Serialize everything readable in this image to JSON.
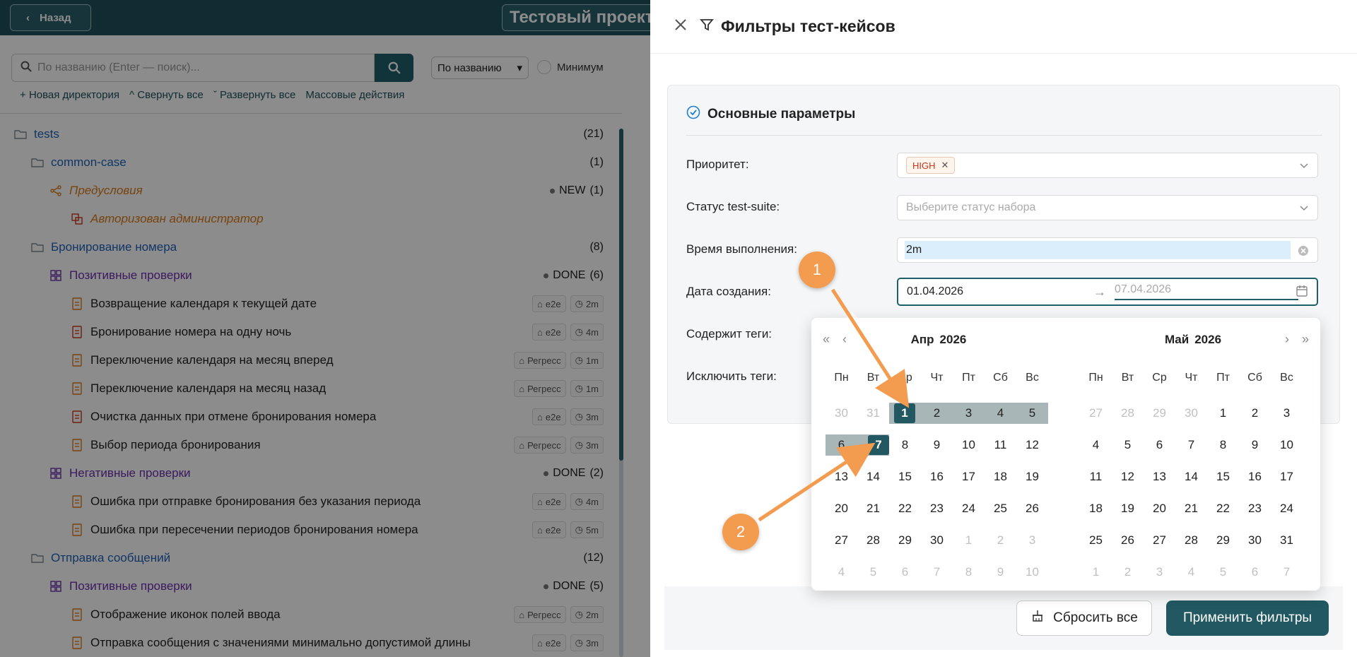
{
  "topbar": {
    "back_label": "Назад",
    "project_title": "Тестовый проект"
  },
  "search": {
    "placeholder": "По названию (Enter — поиск)...",
    "sort_value": "По названию",
    "min_label": "Минимум"
  },
  "toolbar": {
    "new_dir": "Новая директория",
    "collapse": "Свернуть все",
    "expand": "Развернуть все",
    "bulk": "Массовые действия"
  },
  "tree": [
    {
      "kind": "folder",
      "level": 0,
      "title": "tests",
      "count": "(21)"
    },
    {
      "kind": "folder",
      "level": 1,
      "title": "common-case",
      "count": "(1)"
    },
    {
      "kind": "pre",
      "level": 2,
      "title": "Предусловия",
      "status": "NEW",
      "count": "(1)"
    },
    {
      "kind": "pre-item",
      "level": 3,
      "title": "Авторизован администратор"
    },
    {
      "kind": "folder",
      "level": 1,
      "title": "Бронирование номера",
      "count": "(8)"
    },
    {
      "kind": "group",
      "level": 2,
      "title": "Позитивные проверки",
      "status": "DONE",
      "count": "(6)"
    },
    {
      "kind": "case",
      "level": 3,
      "title": "Возвращение календаря к текущей дате",
      "tag": "e2e",
      "time": "2m"
    },
    {
      "kind": "case-red",
      "level": 3,
      "title": "Бронирование номера на одну ночь",
      "tag": "e2e",
      "time": "4m"
    },
    {
      "kind": "case",
      "level": 3,
      "title": "Переключение календаря на месяц вперед",
      "tag": "Регресс",
      "time": "1m"
    },
    {
      "kind": "case",
      "level": 3,
      "title": "Переключение календаря на месяц назад",
      "tag": "Регресс",
      "time": "1m"
    },
    {
      "kind": "case-red",
      "level": 3,
      "title": "Очистка данных при отмене бронирования номера",
      "tag": "e2e",
      "time": "3m"
    },
    {
      "kind": "case",
      "level": 3,
      "title": "Выбор периода бронирования",
      "tag": "Регресс",
      "time": "3m"
    },
    {
      "kind": "group",
      "level": 2,
      "title": "Негативные проверки",
      "status": "DONE",
      "count": "(2)"
    },
    {
      "kind": "case",
      "level": 3,
      "title": "Ошибка при отправке бронирования без указания периода",
      "tag": "e2e",
      "time": "4m"
    },
    {
      "kind": "case",
      "level": 3,
      "title": "Ошибка при пересечении периодов бронирования номера",
      "tag": "e2e",
      "time": "5m"
    },
    {
      "kind": "folder",
      "level": 1,
      "title": "Отправка сообщений",
      "count": "(12)"
    },
    {
      "kind": "group",
      "level": 2,
      "title": "Позитивные проверки",
      "status": "DONE",
      "count": "(5)"
    },
    {
      "kind": "case",
      "level": 3,
      "title": "Отображение иконок полей ввода",
      "tag": "Регресс",
      "time": "2m"
    },
    {
      "kind": "case",
      "level": 3,
      "title": "Отправка сообщения с значениями минимально допустимой длины",
      "tag": "e2e",
      "time": "3m"
    }
  ],
  "drawer": {
    "title": "Фильтры тест-кейсов",
    "section_title": "Основные параметры",
    "fields": {
      "priority_label": "Приоритет:",
      "priority_chip": "HIGH",
      "suite_status_label": "Статус test-suite:",
      "suite_status_placeholder": "Выберите статус набора",
      "duration_label": "Время выполнения:",
      "duration_value": "2m",
      "created_label": "Дата создания:",
      "created_start": "01.04.2026",
      "created_end": "07.04.2026",
      "tags_include_label": "Содержит теги:",
      "tags_exclude_label": "Исключить теги:"
    },
    "reset_label": "Сбросить все",
    "apply_label": "Применить фильтры"
  },
  "calendar": {
    "weekdays": [
      "Пн",
      "Вт",
      "Ср",
      "Чт",
      "Пт",
      "Сб",
      "Вс"
    ],
    "months": [
      {
        "month": "Апр",
        "year": "2026",
        "weeks": [
          [
            "30",
            "31",
            "1",
            "2",
            "3",
            "4",
            "5"
          ],
          [
            "6",
            "7",
            "8",
            "9",
            "10",
            "11",
            "12"
          ],
          [
            "13",
            "14",
            "15",
            "16",
            "17",
            "18",
            "19"
          ],
          [
            "20",
            "21",
            "22",
            "23",
            "24",
            "25",
            "26"
          ],
          [
            "27",
            "28",
            "29",
            "30",
            "1",
            "2",
            "3"
          ],
          [
            "4",
            "5",
            "6",
            "7",
            "8",
            "9",
            "10"
          ]
        ],
        "muted": [
          [
            0,
            0
          ],
          [
            0,
            1
          ],
          [
            4,
            4
          ],
          [
            4,
            5
          ],
          [
            4,
            6
          ],
          [
            5,
            0
          ],
          [
            5,
            1
          ],
          [
            5,
            2
          ],
          [
            5,
            3
          ],
          [
            5,
            4
          ],
          [
            5,
            5
          ],
          [
            5,
            6
          ]
        ],
        "range": [
          [
            0,
            3
          ],
          [
            0,
            4
          ],
          [
            0,
            5
          ],
          [
            0,
            6
          ],
          [
            1,
            0
          ]
        ],
        "edges": [
          [
            0,
            2
          ],
          [
            1,
            1
          ]
        ]
      },
      {
        "month": "Май",
        "year": "2026",
        "weeks": [
          [
            "27",
            "28",
            "29",
            "30",
            "1",
            "2",
            "3"
          ],
          [
            "4",
            "5",
            "6",
            "7",
            "8",
            "9",
            "10"
          ],
          [
            "11",
            "12",
            "13",
            "14",
            "15",
            "16",
            "17"
          ],
          [
            "18",
            "19",
            "20",
            "21",
            "22",
            "23",
            "24"
          ],
          [
            "25",
            "26",
            "27",
            "28",
            "29",
            "30",
            "31"
          ],
          [
            "1",
            "2",
            "3",
            "4",
            "5",
            "6",
            "7"
          ]
        ],
        "muted": [
          [
            0,
            0
          ],
          [
            0,
            1
          ],
          [
            0,
            2
          ],
          [
            0,
            3
          ],
          [
            5,
            0
          ],
          [
            5,
            1
          ],
          [
            5,
            2
          ],
          [
            5,
            3
          ],
          [
            5,
            4
          ],
          [
            5,
            5
          ],
          [
            5,
            6
          ]
        ],
        "range": [],
        "edges": []
      }
    ]
  },
  "callouts": [
    "1",
    "2"
  ],
  "colors": {
    "accent": "#215862",
    "range": "#a9b6b7",
    "callout": "#f39b4e",
    "folder": "#1f62b8",
    "group": "#6a2fae",
    "pre": "#d97a19"
  }
}
